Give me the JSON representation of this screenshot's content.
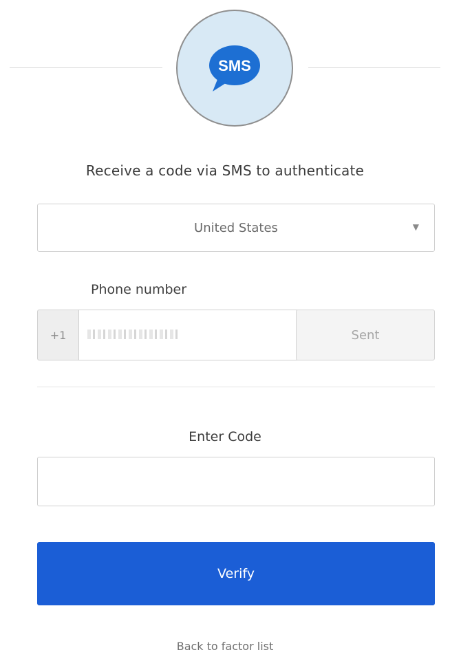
{
  "badge": {
    "text": "SMS",
    "bubble_color": "#1d6fd3"
  },
  "heading": "Receive a code via SMS to authenticate",
  "country_select": {
    "value": "United States",
    "caret": "▼"
  },
  "phone": {
    "label": "Phone number",
    "prefix": "+1",
    "send_button_label": "Sent"
  },
  "code": {
    "label": "Enter Code",
    "value": ""
  },
  "verify_button": {
    "label": "Verify",
    "color": "#1b5ed6"
  },
  "back_link": "Back to factor list"
}
